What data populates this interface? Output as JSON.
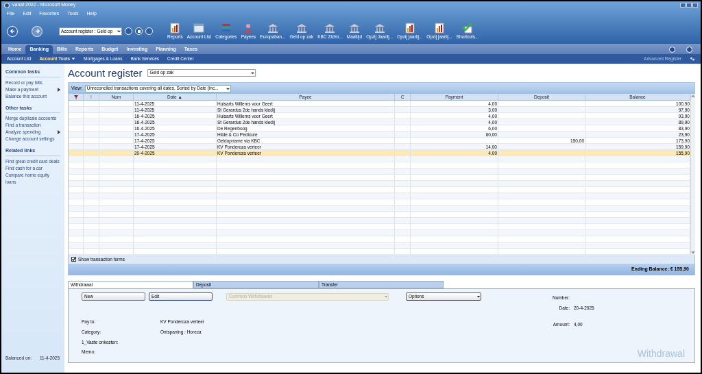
{
  "window": {
    "title": "vanaf 2022 - Microsoft Money"
  },
  "menu": [
    "File",
    "Edit",
    "Favorites",
    "Tools",
    "Help"
  ],
  "address": {
    "value": "Account register : Geld op"
  },
  "toolbar": [
    {
      "label": "Reports",
      "kind": "chart"
    },
    {
      "label": "Account List",
      "kind": "list"
    },
    {
      "label": "Categories",
      "kind": "categories"
    },
    {
      "label": "Payees",
      "kind": "person"
    },
    {
      "label": "Europaban...",
      "kind": "bank"
    },
    {
      "label": "Geld op zak",
      "kind": "bank"
    },
    {
      "label": "KBC Zichtr...",
      "kind": "bank"
    },
    {
      "label": "Maaltijd",
      "kind": "bank"
    },
    {
      "label": "Opzij Jaarlij...",
      "kind": "bank"
    },
    {
      "label": "Opzij jaarlij...",
      "kind": "chart"
    },
    {
      "label": "Opzij jaarlij...",
      "kind": "chart"
    },
    {
      "label": "Shortcuts...",
      "kind": "check"
    }
  ],
  "nav_tabs": [
    {
      "label": "Home",
      "selected": false
    },
    {
      "label": "Banking",
      "selected": true
    },
    {
      "label": "Bills",
      "selected": false
    },
    {
      "label": "Reports",
      "selected": false
    },
    {
      "label": "Budget",
      "selected": false
    },
    {
      "label": "Investing",
      "selected": false
    },
    {
      "label": "Planning",
      "selected": false
    },
    {
      "label": "Taxes",
      "selected": false
    }
  ],
  "sub_nav": [
    {
      "label": "Account List",
      "selected": false,
      "has_menu": false
    },
    {
      "label": "Account Tools",
      "selected": true,
      "has_menu": true
    },
    {
      "label": "Mortgages & Loans",
      "selected": false,
      "has_menu": false
    },
    {
      "label": "Bank Services",
      "selected": false,
      "has_menu": false
    },
    {
      "label": "Credit Center",
      "selected": false,
      "has_menu": false
    }
  ],
  "advanced_register": "Advanced Register",
  "sidebar": {
    "sections": [
      {
        "title": "Common tasks",
        "items": [
          {
            "label": "Record or pay bills",
            "has_submenu": false
          },
          {
            "label": "Make a payment",
            "has_submenu": true
          },
          {
            "label": "Balance this account",
            "has_submenu": false
          }
        ]
      },
      {
        "title": "Other tasks",
        "items": [
          {
            "label": "Merge duplicate accounts",
            "has_submenu": false
          },
          {
            "label": "Find a transaction",
            "has_submenu": false
          },
          {
            "label": "Analyze spending",
            "has_submenu": true
          },
          {
            "label": "Change account settings",
            "has_submenu": false
          }
        ]
      },
      {
        "title": "Related links",
        "items": [
          {
            "label": "Find great credit card deals",
            "has_submenu": false
          },
          {
            "label": "Find cash for a car",
            "has_submenu": false
          },
          {
            "label": "Compare home equity loans",
            "has_submenu": false
          }
        ]
      }
    ],
    "balanced_label": "Balanced on:",
    "balanced_date": "11-4-2025"
  },
  "register": {
    "title": "Account register",
    "account": "Geld op zak",
    "view_label": "View:",
    "view": "Unreconciled transactions covering all dates, Sorted by Date (inc...",
    "columns": [
      "!",
      "Num",
      "Date ▲",
      "Payee",
      "C",
      "Payment",
      "Deposit",
      "Balance"
    ],
    "rows": [
      {
        "date": "11-4-2025",
        "payee": "Huisarts Willems voor Geert",
        "payment": "4,00",
        "deposit": "",
        "balance": "100,90",
        "selected": false
      },
      {
        "date": "11-4-2025",
        "payee": "St Gerardus 2de hands kledij",
        "payment": "3,00",
        "deposit": "",
        "balance": "97,90",
        "selected": false
      },
      {
        "date": "16-4-2025",
        "payee": "Huisarts Willems voor Geert",
        "payment": "4,00",
        "deposit": "",
        "balance": "93,90",
        "selected": false
      },
      {
        "date": "16-4-2025",
        "payee": "St Gerardus 2de hands kledij",
        "payment": "4,00",
        "deposit": "",
        "balance": "89,90",
        "selected": false
      },
      {
        "date": "16-4-2025",
        "payee": "De Regenboog",
        "payment": "6,00",
        "deposit": "",
        "balance": "83,90",
        "selected": false
      },
      {
        "date": "17-4-2025",
        "payee": "Hilde & Co Pedicure",
        "payment": "60,00",
        "deposit": "",
        "balance": "23,90",
        "selected": false
      },
      {
        "date": "17-4-2025",
        "payee": "Geldopname via KBC",
        "payment": "",
        "deposit": "150,00",
        "balance": "173,90",
        "selected": false
      },
      {
        "date": "17-4-2025",
        "payee": "KV Ponderoza verteer",
        "payment": "14,00",
        "deposit": "",
        "balance": "159,90",
        "selected": false
      },
      {
        "date": "20-4-2025",
        "payee": "KV Ponderoza verteer",
        "payment": "4,00",
        "deposit": "",
        "balance": "155,90",
        "selected": true
      }
    ],
    "show_forms": {
      "label": "Show transaction forms",
      "checked": true
    },
    "ending_balance": "Ending Balance: € 155,90"
  },
  "form": {
    "tabs": [
      {
        "label": "Withdrawal",
        "selected": true
      },
      {
        "label": "Deposit",
        "selected": false
      },
      {
        "label": "Transfer",
        "selected": false
      }
    ],
    "buttons": [
      {
        "label": "New",
        "focused": false
      },
      {
        "label": "Edit",
        "focused": true
      }
    ],
    "common": {
      "label": "Common Withdrawals",
      "disabled": true
    },
    "options": "Options",
    "fields": [
      {
        "label": "Pay to:",
        "value": "KV Ponderoza verteer"
      },
      {
        "label": "Category:",
        "value": "Ontspaning : Horeca"
      },
      {
        "label": "1_Vaste onkosten:"
      },
      {
        "label": "Memo:"
      }
    ],
    "number_label": "Number:",
    "date_label": "Date:",
    "date": "20-4-2025",
    "amount_label": "Amount:",
    "amount": "4,00",
    "watermark": "Withdrawal"
  }
}
